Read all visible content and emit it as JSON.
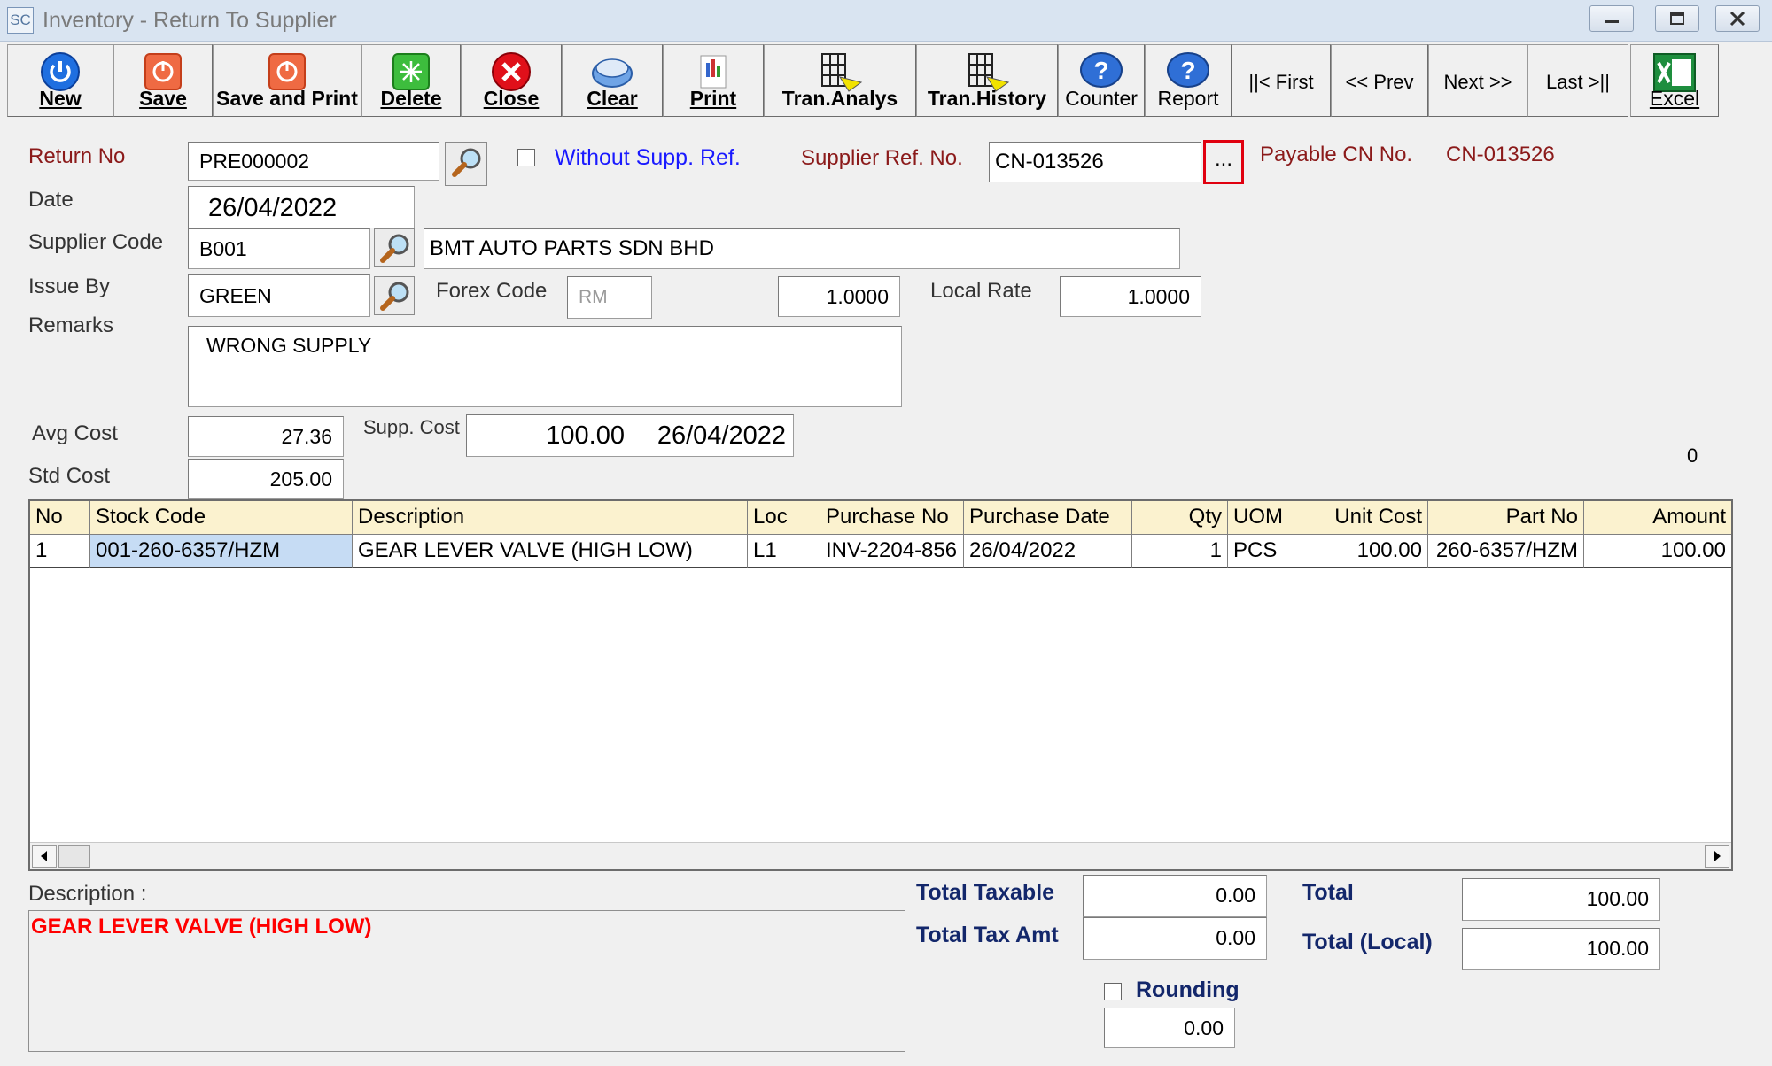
{
  "window": {
    "app_icon": "SC",
    "title": "Inventory - Return To Supplier"
  },
  "toolbar": {
    "new": "New",
    "save": "Save",
    "save_print": "Save and Print",
    "delete": "Delete",
    "close": "Close",
    "clear": "Clear",
    "print": "Print",
    "tran_analys": "Tran.Analys",
    "tran_history": "Tran.History",
    "counter": "Counter",
    "report": "Report",
    "first": "||< First",
    "prev": "<< Prev",
    "next": "Next >>",
    "last": "Last >||",
    "excel": "Excel"
  },
  "header": {
    "return_no_label": "Return  No",
    "return_no": "PRE000002",
    "without_supp_ref_label": "Without Supp. Ref.",
    "supplier_ref_label": "Supplier Ref. No.",
    "supplier_ref": "CN-013526",
    "ellipsis": "...",
    "payable_cn_label": "Payable CN No.",
    "payable_cn": "CN-013526",
    "date_label": "Date",
    "date": "26/04/2022",
    "supplier_code_label": "Supplier Code",
    "supplier_code": "B001",
    "supplier_name": "BMT AUTO PARTS SDN BHD",
    "issue_by_label": "Issue By",
    "issue_by": "GREEN",
    "forex_code_label": "Forex Code",
    "forex_code": "RM",
    "forex_rate": "1.0000",
    "local_rate_label": "Local Rate",
    "local_rate": "1.0000",
    "remarks_label": "Remarks",
    "remarks": "WRONG SUPPLY",
    "avg_cost_label": "Avg Cost",
    "avg_cost": "27.36",
    "supp_cost_label": "Supp. Cost",
    "supp_cost": "100.00",
    "supp_cost_date": "26/04/2022",
    "std_cost_label": "Std Cost",
    "std_cost": "205.00",
    "zero_indicator": "0"
  },
  "grid": {
    "columns": [
      "No",
      "Stock Code",
      "Description",
      "Loc",
      "Purchase No",
      "Purchase Date",
      "Qty",
      "UOM",
      "Unit Cost",
      "Part No",
      "Amount"
    ],
    "rows": [
      [
        "1",
        "001-260-6357/HZM",
        "GEAR LEVER VALVE (HIGH LOW)",
        "L1",
        "INV-2204-856",
        "26/04/2022",
        "1",
        "PCS",
        "100.00",
        "260-6357/HZM",
        "100.00"
      ]
    ]
  },
  "footer": {
    "description_label": "Description :",
    "description": "GEAR LEVER VALVE (HIGH LOW)",
    "total_taxable_label": "Total Taxable",
    "total_taxable": "0.00",
    "total_tax_amt_label": "Total Tax Amt",
    "total_tax_amt": "0.00",
    "rounding_label": "Rounding",
    "rounding": "0.00",
    "total_label": "Total",
    "total": "100.00",
    "total_local_label": "Total (Local)",
    "total_local": "100.00"
  },
  "colors": {
    "label_red": "#8b1a1a",
    "link_blue": "#1a1aff",
    "desc_red": "#ff0000",
    "header_yellow": "#fbf2cf",
    "highlight": "#e0000f"
  }
}
